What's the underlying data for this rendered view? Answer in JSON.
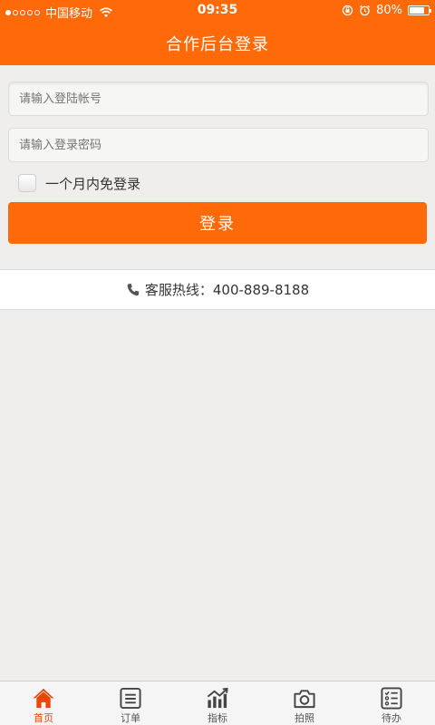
{
  "status_bar": {
    "carrier": "中国移动",
    "time": "09:35",
    "battery": "80%",
    "battery_level": 0.8
  },
  "header": {
    "title": "合作后台登录"
  },
  "form": {
    "username_placeholder": "请输入登陆帐号",
    "password_placeholder": "请输入登录密码",
    "remember_label": "一个月内免登录",
    "remember_checked": false,
    "login_label": "登录"
  },
  "hotline": {
    "text": "客服热线：400-889-8188"
  },
  "tabbar": {
    "items": [
      {
        "label": "首页",
        "icon": "home-icon",
        "active": true
      },
      {
        "label": "订单",
        "icon": "order-list-icon",
        "active": false
      },
      {
        "label": "指标",
        "icon": "chart-icon",
        "active": false
      },
      {
        "label": "拍照",
        "icon": "camera-icon",
        "active": false
      },
      {
        "label": "待办",
        "icon": "checklist-icon",
        "active": false
      }
    ]
  },
  "colors": {
    "brand": "#fe6a0a",
    "background": "#efeeec",
    "active_tab": "#e8470a"
  }
}
